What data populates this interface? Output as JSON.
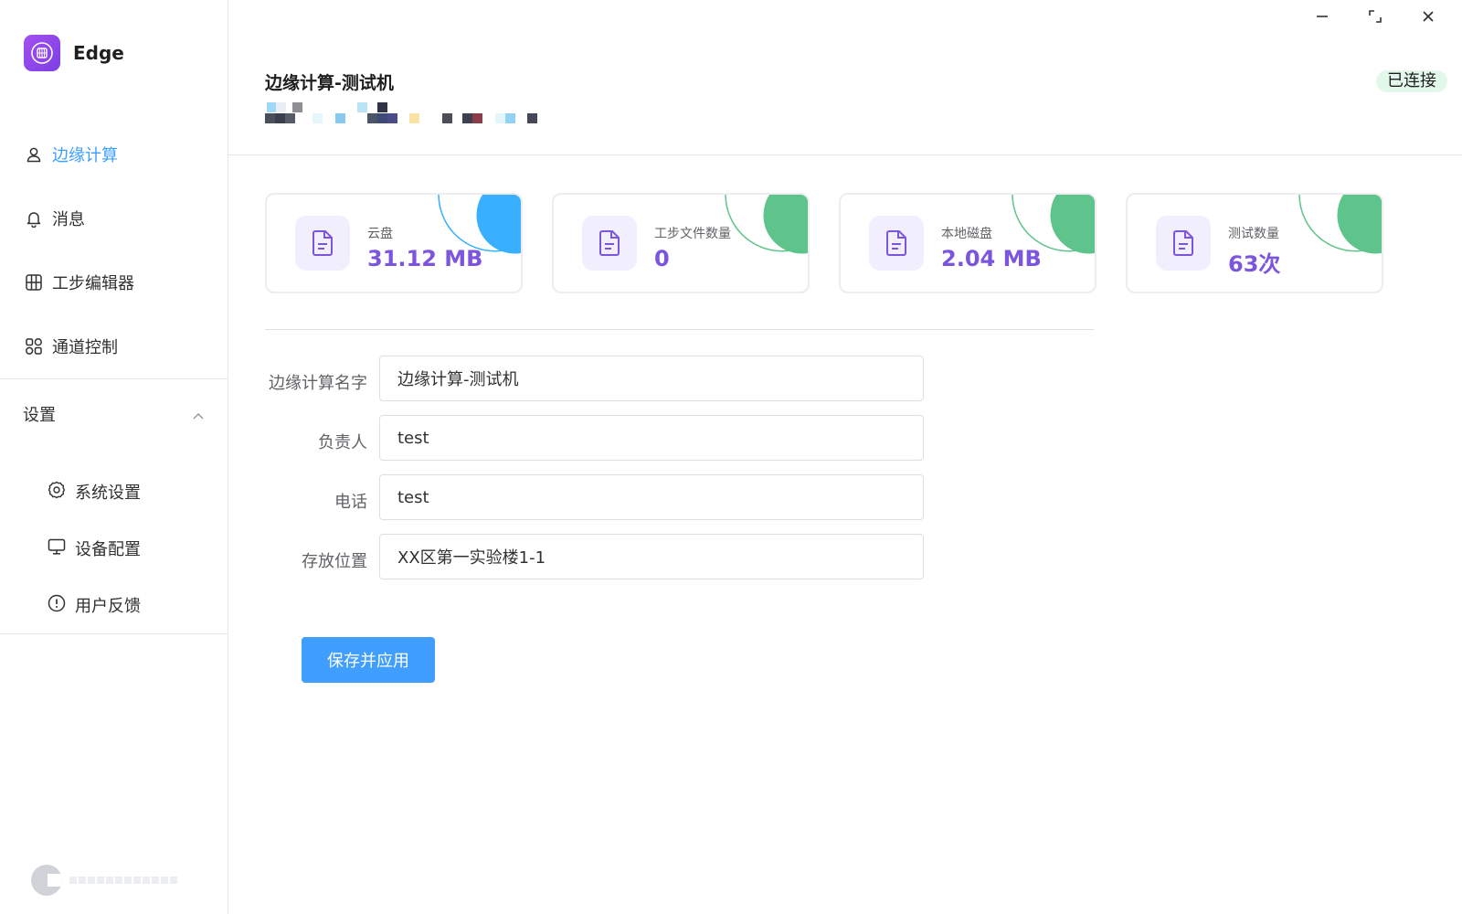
{
  "app": {
    "name": "Edge"
  },
  "sidebar": {
    "items": [
      {
        "label": "边缘计算",
        "icon": "user-icon",
        "active": true
      },
      {
        "label": "消息",
        "icon": "bell-icon"
      },
      {
        "label": "工步编辑器",
        "icon": "grid-icon"
      },
      {
        "label": "通道控制",
        "icon": "apps-icon"
      }
    ],
    "settings": {
      "label": "设置",
      "expanded": true,
      "items": [
        {
          "label": "系统设置",
          "icon": "gear-icon"
        },
        {
          "label": "设备配置",
          "icon": "monitor-icon"
        },
        {
          "label": "用户反馈",
          "icon": "alert-circle-icon"
        }
      ]
    }
  },
  "header": {
    "title": "边缘计算-测试机",
    "status": "已连接",
    "status_color": "#e1f8ea"
  },
  "cards": [
    {
      "label": "云盘",
      "value": "31.12 MB",
      "accent": "#38b0ff",
      "icon": "document-icon"
    },
    {
      "label": "工步文件数量",
      "value": "0",
      "accent": "#5ec48b",
      "icon": "document-icon"
    },
    {
      "label": "本地磁盘",
      "value": "2.04 MB",
      "accent": "#5ec48b",
      "icon": "document-icon"
    },
    {
      "label": "测试数量",
      "value": "63次",
      "accent": "#5ec48b",
      "icon": "document-icon"
    }
  ],
  "form": {
    "name": {
      "label": "边缘计算名字",
      "value": "边缘计算-测试机"
    },
    "owner": {
      "label": "负责人",
      "value": "test"
    },
    "phone": {
      "label": "电话",
      "value": "test"
    },
    "location": {
      "label": "存放位置",
      "value": "XX区第一实验楼1-1"
    },
    "submit_label": "保存并应用"
  },
  "colors": {
    "primary": "#409eff",
    "value_purple": "#7b55dd"
  }
}
